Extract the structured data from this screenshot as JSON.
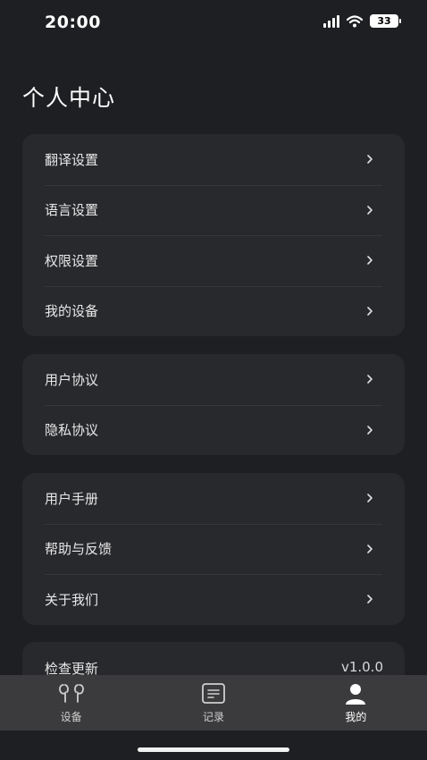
{
  "status_bar": {
    "time": "20:00",
    "battery": "33"
  },
  "page": {
    "title": "个人中心"
  },
  "groups": [
    {
      "items": [
        {
          "label": "翻译设置"
        },
        {
          "label": "语言设置"
        },
        {
          "label": "权限设置"
        },
        {
          "label": "我的设备"
        }
      ]
    },
    {
      "items": [
        {
          "label": "用户协议"
        },
        {
          "label": "隐私协议"
        }
      ]
    },
    {
      "items": [
        {
          "label": "用户手册"
        },
        {
          "label": "帮助与反馈"
        },
        {
          "label": "关于我们"
        }
      ]
    },
    {
      "items": [
        {
          "label": "检查更新",
          "value": "v1.0.0"
        }
      ]
    }
  ],
  "tabbar": {
    "items": [
      {
        "label": "设备",
        "icon": "earbuds-icon"
      },
      {
        "label": "记录",
        "icon": "record-icon"
      },
      {
        "label": "我的",
        "icon": "person-icon",
        "active": true
      }
    ]
  },
  "colors": {
    "background": "#1e1f22",
    "card": "#28292d",
    "tabbar": "#3b3b3d"
  }
}
